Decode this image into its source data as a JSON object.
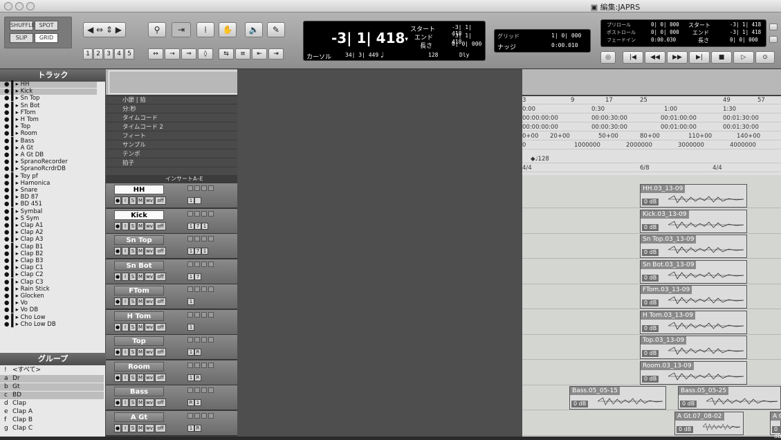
{
  "window": {
    "title": "編集:JAPRS"
  },
  "toolbar": {
    "modes": [
      "SHUFFLE",
      "SPOT",
      "SLIP",
      "GRID"
    ],
    "zoom_presets": [
      "1",
      "2",
      "3",
      "4",
      "5"
    ],
    "main_counter": "-3| 1| 418",
    "counter_arrow": "▾",
    "start_label": "スタート",
    "start_value": "-3| 1| 418",
    "end_label": "エンド",
    "end_value": "-3| 1| 418",
    "length_label": "長さ",
    "length_value": "0| 0| 000",
    "cursor_label": "カーソル",
    "cursor_value": "34| 3| 449",
    "tempo": "128",
    "dly": "Dly",
    "grid_label": "グリッド",
    "grid_value": "1| 0| 000",
    "nudge_label": "ナッジ",
    "nudge_value": "0:00.010",
    "preroll_label": "プリロール",
    "preroll_value": "0| 0| 000",
    "postroll_label": "ポストロール",
    "postroll_value": "0| 0| 000",
    "fadein_label": "フェードイン",
    "fadein_value": "0:00.030",
    "start2_label": "スタート",
    "start2_value": "-3| 1| 418",
    "end2_label": "エンド",
    "end2_value": "-3| 1| 418",
    "length2_label": "長さ",
    "length2_value": "0| 0| 000"
  },
  "tracks_panel": {
    "title": "トラック",
    "items": [
      "HH",
      "Kick",
      "Sn Top",
      "Sn Bot",
      "FTom",
      "H Tom",
      "Top",
      "Room",
      "Bass",
      "A Gt",
      "A Gt DB",
      "SpranoRecorder",
      "SpranoRcrdrDB",
      "Toy pf",
      "Hamonica",
      "Snare",
      "BD 87",
      "BD 451",
      "Symbal",
      "S Sym",
      "Clap A1",
      "Clap A2",
      "Clap A3",
      "Clap B1",
      "Clap B2",
      "Clap B3",
      "Clap C1",
      "Clap C2",
      "Clap C3",
      "Rain Stick",
      "Glocken",
      "Vo",
      "Vo DB",
      "Cho Low",
      "Cho Low DB"
    ]
  },
  "groups_panel": {
    "title": "グループ",
    "items": [
      {
        "id": "!",
        "name": "<すべて>"
      },
      {
        "id": "a",
        "name": "Dr"
      },
      {
        "id": "b",
        "name": "Gt"
      },
      {
        "id": "c",
        "name": "BD"
      },
      {
        "id": "d",
        "name": "Clap"
      },
      {
        "id": "e",
        "name": "Clap A"
      },
      {
        "id": "f",
        "name": "Clap B"
      },
      {
        "id": "g",
        "name": "Clap C"
      }
    ]
  },
  "rulers": {
    "labels": [
      "小節 | 拍",
      "分:秒",
      "タイムコード",
      "タイムコード 2",
      "フィート",
      "サンプル",
      "テンポ",
      "拍子"
    ],
    "insert_label": "インサートA–E"
  },
  "ruler_values": {
    "bars": [
      "3",
      "9",
      "17",
      "25",
      "49",
      "57"
    ],
    "minsec": [
      "0:00",
      "0:30",
      "1:00",
      "1:30"
    ],
    "timecode": [
      "00:00:00:00",
      "00:00:30:00",
      "00:01:00:00",
      "00:01:30:00"
    ],
    "timecode2": [
      "00:00:00:00",
      "00:00:30:00",
      "00:01:00:00",
      "00:01:30:00"
    ],
    "feet": [
      "0+00",
      "20+00",
      "50+00",
      "80+00",
      "110+00",
      "140+00"
    ],
    "samples": [
      "0",
      "1000000",
      "2000000",
      "3000000",
      "4000000"
    ],
    "tempo": "128",
    "meter": [
      "4/4",
      "6/8",
      "4/4"
    ]
  },
  "track_rows": [
    {
      "name": "HH",
      "ins": [
        "1",
        ""
      ],
      "sel": true
    },
    {
      "name": "Kick",
      "ins": [
        "1",
        "7",
        "1"
      ],
      "sel": true
    },
    {
      "name": "Sn Top",
      "ins": [
        "1",
        "7",
        "1"
      ],
      "sel": false
    },
    {
      "name": "Sn Bot",
      "ins": [
        "1",
        "7"
      ],
      "sel": false
    },
    {
      "name": "FTom",
      "ins": [
        "1"
      ],
      "sel": false
    },
    {
      "name": "H Tom",
      "ins": [
        "1"
      ],
      "sel": false
    },
    {
      "name": "Top",
      "ins": [
        "1",
        "R"
      ],
      "sel": false
    },
    {
      "name": "Room",
      "ins": [
        "1",
        "R"
      ],
      "sel": false
    },
    {
      "name": "Bass",
      "ins": [
        "R",
        "1"
      ],
      "sel": false
    },
    {
      "name": "A Gt",
      "ins": [
        "1",
        "R"
      ],
      "sel": false
    }
  ],
  "track_buttons": {
    "rec": "●",
    "input": "I",
    "solo": "S",
    "mute": "M",
    "view": "wv",
    "auto": "off"
  },
  "clips": [
    "HH.03_13-09",
    "Kick.03_13-09",
    "Sn Top.03_13-09",
    "Sn Bot.03_13-09",
    "FTom.03_13-09",
    "H Tom.03_13-09",
    "Top.03_13-09",
    "Room.03_13-09",
    "Bass.05_05-15",
    "Bass.05_05-25",
    "A Gt.07_08-02",
    "A G"
  ],
  "clip_gain": "0 dB"
}
